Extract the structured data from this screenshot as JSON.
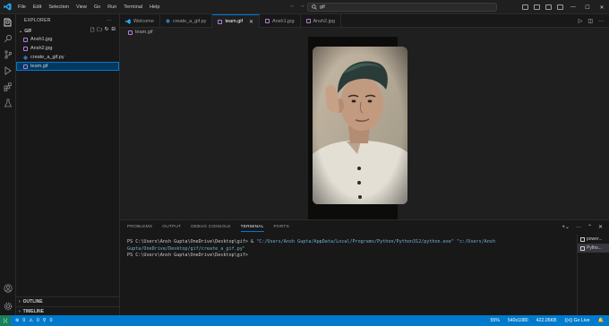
{
  "titlebar": {
    "menu": [
      "File",
      "Edit",
      "Selection",
      "View",
      "Go",
      "Run",
      "Terminal",
      "Help"
    ],
    "search_text": "gif"
  },
  "sidebar": {
    "header": "EXPLORER",
    "folder": "GIF",
    "files": [
      {
        "name": "Ansh1.jpg",
        "icon": "image-file-icon"
      },
      {
        "name": "Ansh2.jpg",
        "icon": "image-file-icon"
      },
      {
        "name": "create_a_gif.py",
        "icon": "python-file-icon"
      },
      {
        "name": "team.gif",
        "icon": "image-file-icon",
        "selected": true
      }
    ],
    "outline_label": "OUTLINE",
    "timeline_label": "TIMELINE"
  },
  "tabs": [
    {
      "label": "Welcome",
      "icon": "vscode-icon"
    },
    {
      "label": "create_a_gif.py",
      "icon": "python-file-icon"
    },
    {
      "label": "team.gif",
      "icon": "image-file-icon",
      "active": true
    },
    {
      "label": "Ansh1.jpg",
      "icon": "image-file-icon"
    },
    {
      "label": "Ansh2.jpg",
      "icon": "image-file-icon"
    }
  ],
  "breadcrumb": "team.gif",
  "panel": {
    "tabs": [
      "PROBLEMS",
      "OUTPUT",
      "DEBUG CONSOLE",
      "TERMINAL",
      "PORTS"
    ],
    "active_tab": "TERMINAL",
    "terminal": {
      "line1_prompt": "PS C:\\Users\\Ansh Gupta\\OneDrive\\Desktop\\gif> & ",
      "line1_cmd": "\"C:/Users/Ansh Gupta/AppData/Local/Programs/Python/Python312/python.exe\" \"c:/Users/Ansh Gupta/OneDrive/Desktop/gif/create_a_gif.py\"",
      "line2": "PS C:\\Users\\Ansh Gupta\\OneDrive\\Desktop\\gif>"
    },
    "terminals": [
      "power...",
      "Pytho..."
    ]
  },
  "statusbar": {
    "errors": "0",
    "warnings": "0",
    "ports": "0",
    "zoom": "55%",
    "dimensions": "540x1080",
    "size": "422.05KB",
    "golive": "Go Live"
  },
  "colors": {
    "accent": "#0078d4",
    "statusbar": "#007acc",
    "remote": "#16825d"
  }
}
